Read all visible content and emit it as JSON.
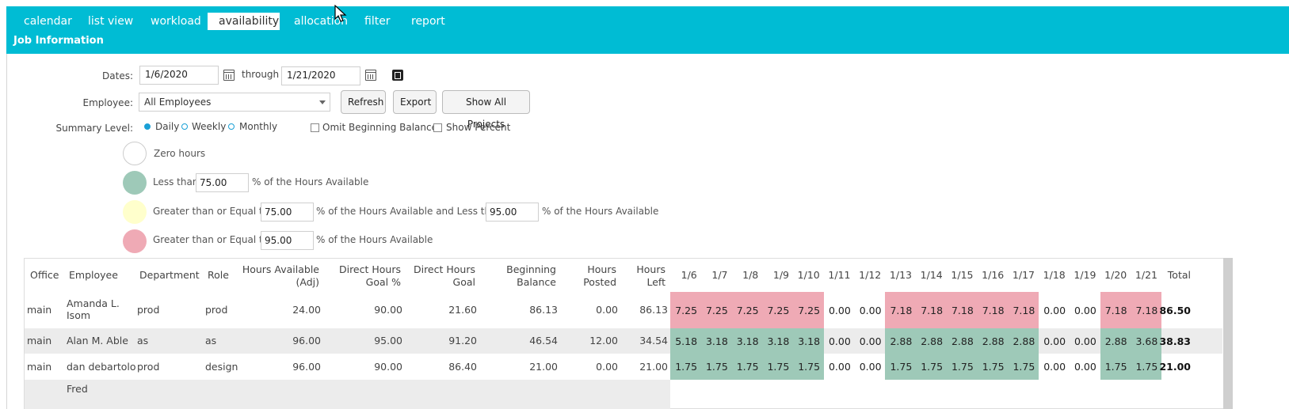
{
  "tabs": [
    {
      "label": "calendar"
    },
    {
      "label": "list view"
    },
    {
      "label": "workload"
    },
    {
      "label": "availability"
    },
    {
      "label": "allocation"
    },
    {
      "label": "filter"
    },
    {
      "label": "report"
    }
  ],
  "active_tab": "availability",
  "job_information": "Job Information",
  "form": {
    "dates_label": "Dates:",
    "date_from": "1/6/2020",
    "through_label": "through",
    "date_to": "1/21/2020",
    "employee_label": "Employee:",
    "employee_value": "All Employees",
    "refresh": "Refresh",
    "export": "Export",
    "show_all_projects": "Show All Projects",
    "summary_label": "Summary Level:",
    "summary_options": [
      "Daily",
      "Weekly",
      "Monthly"
    ],
    "summary_selected": "Daily",
    "omit_beginning_balance": "Omit Beginning Balance",
    "show_percent": "Show Percent"
  },
  "legend": {
    "zero": "Zero hours",
    "less_than": "Less than",
    "pct_hours_available": "% of the Hours Available",
    "ge_equal_to": "Greater than or Equal to",
    "pct_and_less_than": "% of the Hours Available and Less than",
    "green_threshold": "75.00",
    "yellow_low": "75.00",
    "yellow_high": "95.00",
    "pink_threshold": "95.00",
    "colors": {
      "zero": "#ffffff",
      "green": "#9ec9b8",
      "yellow": "#ffffcc",
      "pink": "#efaab5"
    }
  },
  "table": {
    "headers": {
      "office": "Office",
      "employee": "Employee",
      "department": "Department",
      "role": "Role",
      "hours_available_1": "Hours Available",
      "hours_available_2": "(Adj)",
      "direct_goal_pct_1": "Direct Hours",
      "direct_goal_pct_2": "Goal %",
      "direct_goal_1": "Direct Hours",
      "direct_goal_2": "Goal",
      "beg_balance_1": "Beginning",
      "beg_balance_2": "Balance",
      "hours_posted_1": "Hours",
      "hours_posted_2": "Posted",
      "hours_left_1": "Hours",
      "hours_left_2": "Left",
      "days": [
        "1/6",
        "1/7",
        "1/8",
        "1/9",
        "1/10",
        "1/11",
        "1/12",
        "1/13",
        "1/14",
        "1/15",
        "1/16",
        "1/17",
        "1/18",
        "1/19",
        "1/20",
        "1/21"
      ],
      "total": "Total"
    },
    "rows": [
      {
        "office": "main",
        "employee_1": "Amanda L.",
        "employee_2": "Isom",
        "department": "prod",
        "role": "prod",
        "hours_available": "24.00",
        "goal_pct": "90.00",
        "goal": "21.60",
        "beg_balance": "86.13",
        "posted": "0.00",
        "left": "86.13",
        "days": [
          "7.25",
          "7.25",
          "7.25",
          "7.25",
          "7.25",
          "0.00",
          "0.00",
          "7.18",
          "7.18",
          "7.18",
          "7.18",
          "7.18",
          "0.00",
          "0.00",
          "7.18",
          "7.18"
        ],
        "day_colors": [
          "pink",
          "pink",
          "pink",
          "pink",
          "pink",
          "",
          "",
          "pink",
          "pink",
          "pink",
          "pink",
          "pink",
          "",
          "",
          "pink",
          "pink"
        ],
        "total": "86.50"
      },
      {
        "office": "main",
        "employee_1": "Alan M. Able",
        "employee_2": "",
        "department": "as",
        "role": "as",
        "hours_available": "96.00",
        "goal_pct": "95.00",
        "goal": "91.20",
        "beg_balance": "46.54",
        "posted": "12.00",
        "left": "34.54",
        "days": [
          "5.18",
          "3.18",
          "3.18",
          "3.18",
          "3.18",
          "0.00",
          "0.00",
          "2.88",
          "2.88",
          "2.88",
          "2.88",
          "2.88",
          "0.00",
          "0.00",
          "2.88",
          "3.68"
        ],
        "day_colors": [
          "green",
          "green",
          "green",
          "green",
          "green",
          "",
          "",
          "green",
          "green",
          "green",
          "green",
          "green",
          "",
          "",
          "green",
          "green"
        ],
        "total": "38.83"
      },
      {
        "office": "main",
        "employee_1": "dan debartolo",
        "employee_2": "",
        "department": "prod",
        "role": "design",
        "hours_available": "96.00",
        "goal_pct": "90.00",
        "goal": "86.40",
        "beg_balance": "21.00",
        "posted": "0.00",
        "left": "21.00",
        "days": [
          "1.75",
          "1.75",
          "1.75",
          "1.75",
          "1.75",
          "0.00",
          "0.00",
          "1.75",
          "1.75",
          "1.75",
          "1.75",
          "1.75",
          "0.00",
          "0.00",
          "1.75",
          "1.75"
        ],
        "day_colors": [
          "green",
          "green",
          "green",
          "green",
          "green",
          "",
          "",
          "green",
          "green",
          "green",
          "green",
          "green",
          "",
          "",
          "green",
          "green"
        ],
        "total": "21.00"
      },
      {
        "office": "",
        "employee_1": "Fred",
        "employee_2": "",
        "department": "",
        "role": "",
        "hours_available": "",
        "goal_pct": "",
        "goal": "",
        "beg_balance": "",
        "posted": "",
        "left": "",
        "days": [],
        "day_colors": [],
        "total": ""
      }
    ]
  }
}
